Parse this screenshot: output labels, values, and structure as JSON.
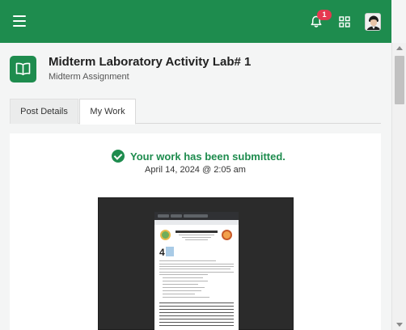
{
  "topbar": {
    "menu_icon": "hamburger-icon",
    "notification_icon": "bell-icon",
    "notification_count": "1",
    "apps_icon": "grid-icon",
    "avatar_icon": "user-avatar",
    "color": "#1e8c4e"
  },
  "header": {
    "icon": "book-icon",
    "title": "Midterm Laboratory Activity Lab# 1",
    "subtitle": "Midterm Assignment"
  },
  "tabs": [
    {
      "label": "Post Details",
      "active": false
    },
    {
      "label": "My Work",
      "active": true
    }
  ],
  "submission": {
    "status_icon": "check-circle-icon",
    "status_text": "Your work has been submitted.",
    "timestamp": "April 14, 2024 @ 2:05 am",
    "attachment": "submitted-screenshot-thumbnail"
  },
  "colors": {
    "accent": "#1e8c4e",
    "badge": "#e53950",
    "background": "#f4f5f5"
  }
}
